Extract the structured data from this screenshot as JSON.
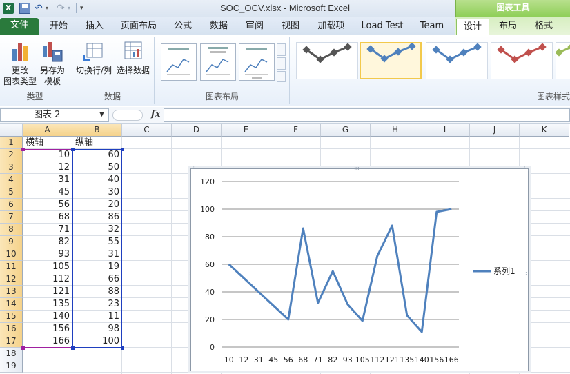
{
  "titlebar": {
    "logo": "X",
    "title": "SOC_OCV.xlsx  -  Microsoft Excel",
    "chart_tools": "图表工具",
    "icons": [
      "excel-logo-icon",
      "save-icon",
      "undo-icon",
      "redo-icon",
      "customize-qat-icon"
    ]
  },
  "tabs": [
    {
      "label": "文件"
    },
    {
      "label": "开始"
    },
    {
      "label": "插入"
    },
    {
      "label": "页面布局"
    },
    {
      "label": "公式"
    },
    {
      "label": "数据"
    },
    {
      "label": "审阅"
    },
    {
      "label": "视图"
    },
    {
      "label": "加载项"
    },
    {
      "label": "Load Test"
    },
    {
      "label": "Team"
    },
    {
      "label": "设计"
    },
    {
      "label": "布局"
    },
    {
      "label": "格式"
    }
  ],
  "ribbon": {
    "type_group": {
      "label": "类型",
      "change_type": [
        "更改",
        "图表类型"
      ],
      "save_template": [
        "另存为",
        "模板"
      ]
    },
    "data_group": {
      "label": "数据",
      "switch_rowcol": "切换行/列",
      "select_data": "选择数据"
    },
    "layout_group": {
      "label": "图表布局"
    },
    "styles_group": {
      "label": "图表样式"
    },
    "style_colors": [
      "#555555",
      "#4f81bd",
      "#4f81bd",
      "#c0504d",
      "#9bbb59"
    ]
  },
  "formula_bar": {
    "name_box": "图表 2",
    "fx": "fx",
    "formula": ""
  },
  "sheet": {
    "columns": [
      "A",
      "B",
      "C",
      "D",
      "E",
      "F",
      "G",
      "H",
      "I",
      "J",
      "K"
    ],
    "rows": [
      "1",
      "2",
      "3",
      "4",
      "5",
      "6",
      "7",
      "8",
      "9",
      "10",
      "11",
      "12",
      "13",
      "14",
      "15",
      "16",
      "17",
      "18",
      "19"
    ],
    "header_a": "横轴",
    "header_b": "纵轴",
    "col_a": [
      "10",
      "12",
      "31",
      "45",
      "56",
      "68",
      "71",
      "82",
      "93",
      "105",
      "112",
      "121",
      "135",
      "140",
      "156",
      "166"
    ],
    "col_b": [
      "60",
      "50",
      "40",
      "30",
      "20",
      "86",
      "32",
      "55",
      "31",
      "19",
      "66",
      "88",
      "23",
      "11",
      "98",
      "100"
    ]
  },
  "chart_data": {
    "type": "line",
    "categories": [
      "10",
      "12",
      "31",
      "45",
      "56",
      "68",
      "71",
      "82",
      "93",
      "105",
      "112",
      "121",
      "135",
      "140",
      "156",
      "166"
    ],
    "series": [
      {
        "name": "系列1",
        "values": [
          60,
          50,
          40,
          30,
          20,
          86,
          32,
          55,
          31,
          19,
          66,
          88,
          23,
          11,
          98,
          100
        ],
        "color": "#4f81bd"
      }
    ],
    "y_ticks": [
      "0",
      "20",
      "40",
      "60",
      "80",
      "100",
      "120"
    ],
    "ylim": [
      0,
      120
    ],
    "grid": true,
    "legend_position": "right"
  }
}
